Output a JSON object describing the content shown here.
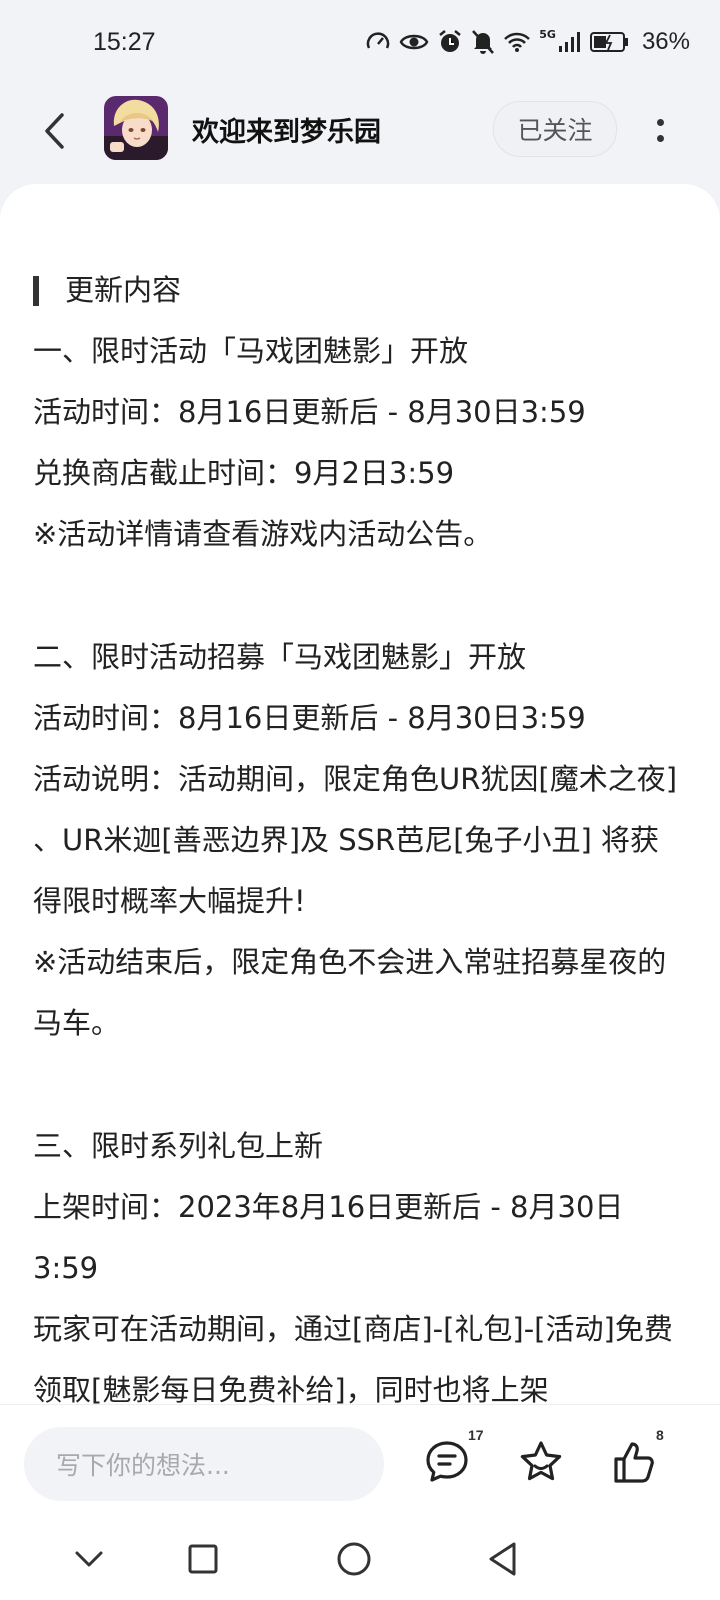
{
  "status_bar": {
    "time": "15:27",
    "network": "5G",
    "battery": "36%"
  },
  "header": {
    "title": "欢迎来到梦乐园",
    "follow_label": "已关注"
  },
  "article": {
    "section_title": "更新内容",
    "blocks": [
      [
        "一、限时活动「马戏团魅影」开放",
        "活动时间：8月16日更新后 - 8月30日3:59",
        "兑换商店截止时间：9月2日3:59",
        "※活动详情请查看游戏内活动公告。"
      ],
      [
        "二、限时活动招募「马戏团魅影」开放",
        "活动时间：8月16日更新后 - 8月30日3:59",
        "活动说明：活动期间，限定角色UR犹因[魔术之夜] 、UR米迦[善恶边界]及 SSR芭尼[兔子小丑] 将获得限时概率大幅提升!",
        "※活动结束后，限定角色不会进入常驻招募星夜的马车。"
      ],
      [
        "三、限时系列礼包上新",
        "上架时间：2023年8月16日更新后 - 8月30日3:59",
        "玩家可在活动期间，通过[商店]-[礼包]-[活动]免费领取[魅影每日免费补给]，同时也将上架"
      ]
    ]
  },
  "bottom_bar": {
    "placeholder": "写下你的想法...",
    "comment_count": "17",
    "like_count": "8"
  },
  "colors": {
    "background": "#f2f3f7",
    "card": "#ffffff",
    "text": "#222222"
  }
}
